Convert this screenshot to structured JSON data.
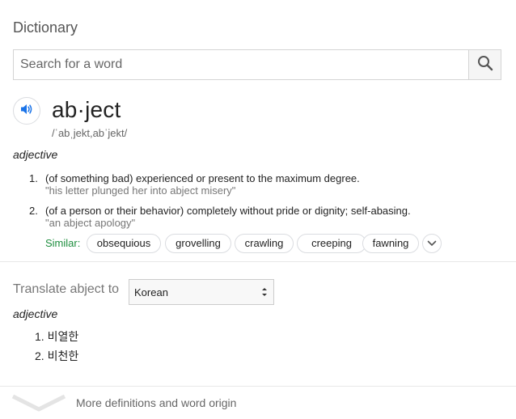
{
  "header": {
    "title": "Dictionary"
  },
  "search": {
    "placeholder": "Search for a word",
    "value": ""
  },
  "entry": {
    "word": "ab·ject",
    "phonetic": "/ˈabˌjekt,abˈjekt/",
    "part_of_speech": "adjective",
    "definitions": [
      {
        "number": "1.",
        "text": "(of something bad) experienced or present to the maximum degree.",
        "example": "\"his letter plunged her into abject misery\""
      },
      {
        "number": "2.",
        "text": "(of a person or their behavior) completely without pride or dignity; self-abasing.",
        "example": "\"an abject apology\""
      }
    ],
    "similar_label": "Similar:",
    "similar": [
      "obsequious",
      "grovelling",
      "crawling",
      "creeping",
      "fawning"
    ]
  },
  "translate": {
    "label": "Translate abject to",
    "language": "Korean",
    "part_of_speech": "adjective",
    "items": [
      {
        "number": "1.",
        "text": "비열한"
      },
      {
        "number": "2.",
        "text": "비천한"
      }
    ]
  },
  "footer": {
    "more_label": "More definitions and word origin"
  },
  "colors": {
    "accent_blue": "#1a73e8",
    "similar_green": "#1e8e3e",
    "border": "#dadce0"
  },
  "icons": {
    "search": "search-icon",
    "audio": "speaker-icon",
    "expand": "chevron-down-icon"
  }
}
